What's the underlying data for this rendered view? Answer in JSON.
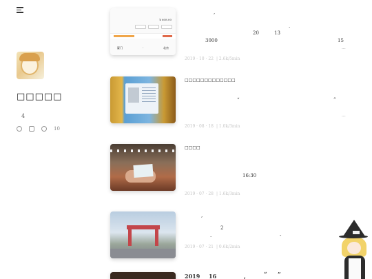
{
  "sidebar": {
    "site_name": "□□□□□",
    "post_count": "4",
    "social_count": "10"
  },
  "posts": [
    {
      "title": "",
      "fragments": [
        ",",
        "20",
        "13",
        ".",
        "3000",
        "15"
      ],
      "meta_date": "2019 · 10 · 22",
      "meta_read": "| 2.6k/5min",
      "excerpt_more": "···"
    },
    {
      "title": "□□□□□□□□□□□□□",
      "fragments": [
        "“",
        "”"
      ],
      "meta_date": "2019 · 08 · 18",
      "meta_read": "| 1.0k/3min",
      "excerpt_more": "···"
    },
    {
      "title": "□□□□",
      "fragments": [
        "16:30"
      ],
      "meta_date": "2019 · 07 · 28",
      "meta_read": "| 1.6k/3min",
      "excerpt_more": ""
    },
    {
      "title": "",
      "fragments": [
        ",",
        "2",
        ".",
        "-"
      ],
      "meta_date": "2019 · 07 · 21",
      "meta_read": "| 0.6k/2min",
      "excerpt_more": ""
    },
    {
      "title_parts": [
        "2019",
        "16",
        ",",
        "“",
        "”"
      ]
    }
  ],
  "ticket_card": {
    "price": "¥ 608.00",
    "origin": "厦门",
    "destination": "北京"
  },
  "icons": [
    "menu-icon",
    "avatar-image",
    "wechat-icon",
    "weibo-icon",
    "github-icon",
    "mascot-image"
  ]
}
